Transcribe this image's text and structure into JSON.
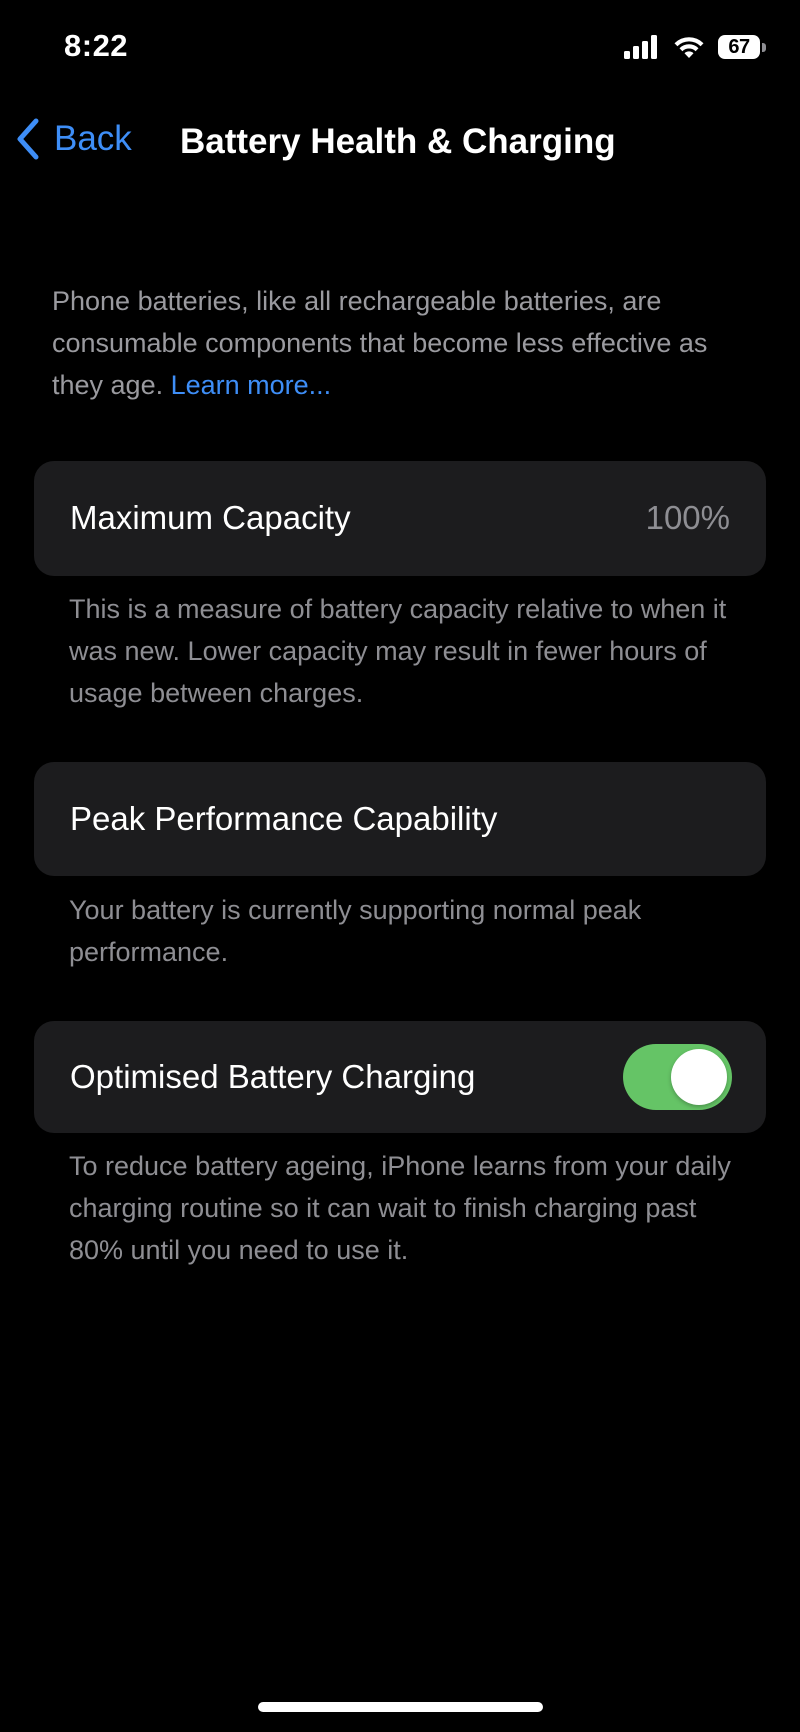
{
  "status_bar": {
    "time": "8:22",
    "battery_level": "67",
    "signal_icon": "cellular-signal-icon",
    "wifi_icon": "wifi-icon",
    "battery_icon": "battery-icon"
  },
  "nav": {
    "back_label": "Back",
    "back_icon": "chevron-left-icon",
    "title": "Battery Health & Charging"
  },
  "intro": {
    "text": "Phone batteries, like all rechargeable batteries, are consumable components that become less effective as they age. ",
    "link_label": "Learn more..."
  },
  "maximum_capacity": {
    "label": "Maximum Capacity",
    "value": "100%",
    "footnote": "This is a measure of battery capacity relative to when it was new. Lower capacity may result in fewer hours of usage between charges."
  },
  "peak_performance": {
    "label": "Peak Performance Capability",
    "footnote": "Your battery is currently supporting normal peak performance."
  },
  "optimised_charging": {
    "label": "Optimised Battery Charging",
    "enabled": true,
    "footnote": "To reduce battery ageing, iPhone learns from your daily charging routine so it can wait to finish charging past 80% until you need to use it."
  },
  "colors": {
    "accent": "#3e8ef7",
    "toggle_on": "#65c466",
    "card_background": "#1c1c1e",
    "secondary_text": "#8e8e93"
  }
}
